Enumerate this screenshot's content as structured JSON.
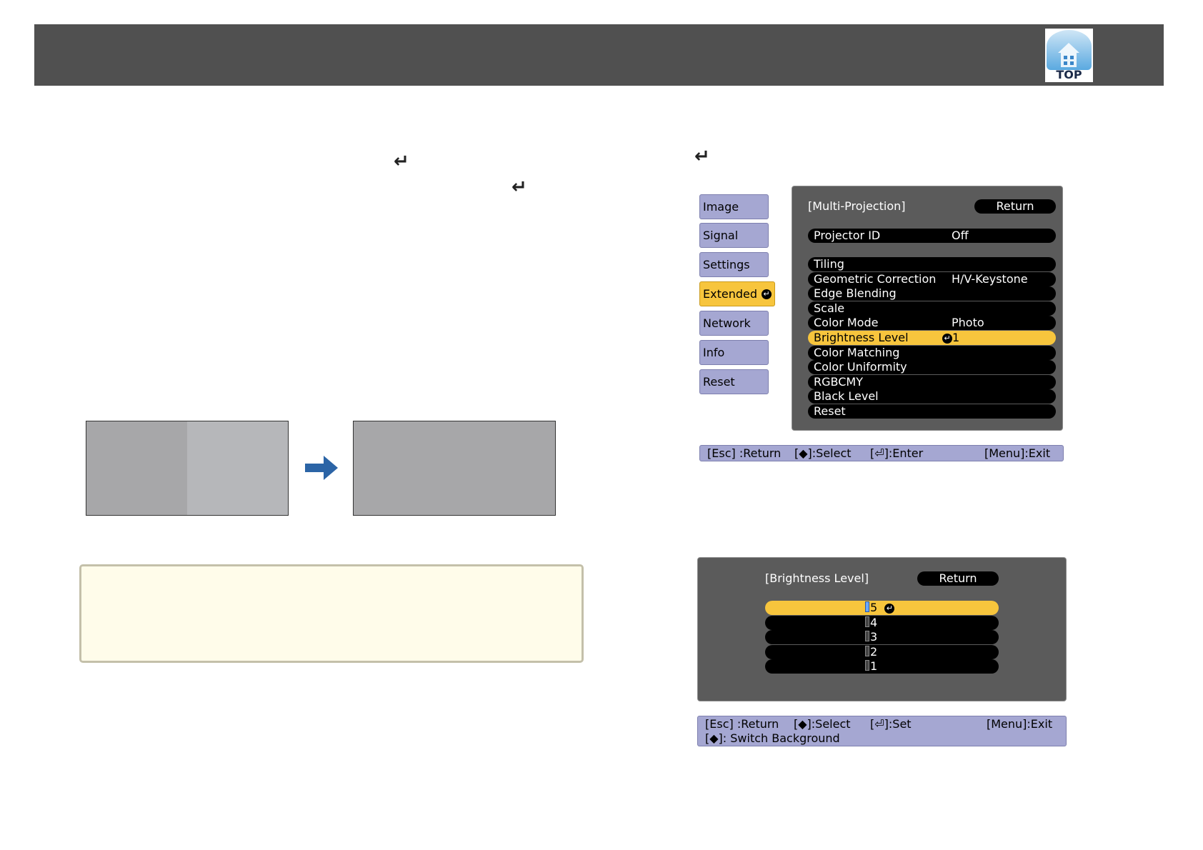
{
  "header": {
    "logo_label": "TOP"
  },
  "icons": {
    "enter": "enter-arrow-icon",
    "right_arrow": "blue-right-arrow-icon",
    "logo": "top-house-icon"
  },
  "colors": {
    "header_bg": "#505050",
    "menu_highlight": "#f7c53d",
    "menu_side": "#a5a7d2",
    "hint_bg": "#fffcea",
    "arrow_blue": "#2b64a6"
  },
  "main_menu": {
    "sidebar": [
      "Image",
      "Signal",
      "Settings",
      "Extended",
      "Network",
      "Info",
      "Reset"
    ],
    "active_item": "Extended",
    "title": "[Multi-Projection]",
    "return_label": "Return",
    "projector_id": {
      "label": "Projector ID",
      "value": "Off"
    },
    "items": [
      {
        "label": "Tiling",
        "value": ""
      },
      {
        "label": "Geometric Correction",
        "value": "H/V-Keystone"
      },
      {
        "label": "Edge Blending",
        "value": ""
      },
      {
        "label": "Scale",
        "value": ""
      },
      {
        "label": "Color Mode",
        "value": "Photo"
      },
      {
        "label": "Brightness Level",
        "value": "1"
      },
      {
        "label": "Color Matching",
        "value": ""
      },
      {
        "label": "Color Uniformity",
        "value": ""
      },
      {
        "label": "RGBCMY",
        "value": ""
      },
      {
        "label": "Black Level",
        "value": ""
      },
      {
        "label": "Reset",
        "value": ""
      }
    ],
    "selected_item": "Brightness Level",
    "status": {
      "esc": "[Esc] :Return",
      "select": "[◆]:Select",
      "enter": "[⏎]:Enter",
      "menu": "[Menu]:Exit"
    }
  },
  "brightness_menu": {
    "title": "[Brightness Level]",
    "return_label": "Return",
    "levels": [
      "5",
      "4",
      "3",
      "2",
      "1"
    ],
    "selected_level": "5",
    "status": {
      "esc": "[Esc] :Return",
      "select": "[◆]:Select",
      "set": "[⏎]:Set",
      "menu": "[Menu]:Exit",
      "switch": "[◆]: Switch Background"
    }
  }
}
